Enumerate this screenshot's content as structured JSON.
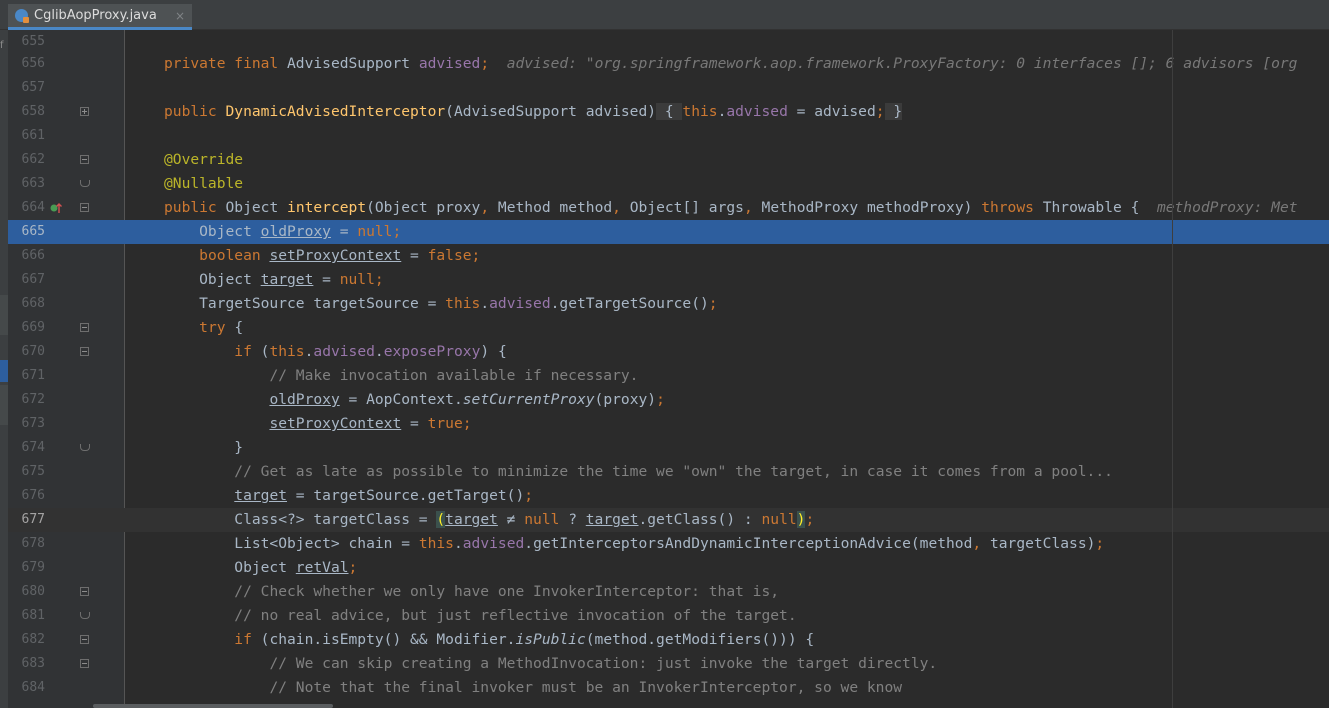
{
  "tab": {
    "filename": "CglibAopProxy.java",
    "close_glyph": "×"
  },
  "lines": [
    {
      "num": "655"
    },
    {
      "num": "656"
    },
    {
      "num": "657"
    },
    {
      "num": "658"
    },
    {
      "num": "661"
    },
    {
      "num": "662"
    },
    {
      "num": "663"
    },
    {
      "num": "664"
    },
    {
      "num": "665"
    },
    {
      "num": "666"
    },
    {
      "num": "667"
    },
    {
      "num": "668"
    },
    {
      "num": "669"
    },
    {
      "num": "670"
    },
    {
      "num": "671"
    },
    {
      "num": "672"
    },
    {
      "num": "673"
    },
    {
      "num": "674"
    },
    {
      "num": "675"
    },
    {
      "num": "676"
    },
    {
      "num": "677"
    },
    {
      "num": "678"
    },
    {
      "num": "679"
    },
    {
      "num": "680"
    },
    {
      "num": "681"
    },
    {
      "num": "682"
    },
    {
      "num": "683"
    },
    {
      "num": "684"
    }
  ],
  "inline_hints": {
    "advised": "advised: \"org.springframework.aop.framework.ProxyFactory: 0 interfaces []; 6 advisors [org",
    "methodProxy": "methodProxy: Met"
  },
  "colors": {
    "keyword": "#cc7832",
    "field": "#9876aa",
    "method_decl": "#ffc66d",
    "annotation": "#bbb529",
    "comment": "#808080",
    "execution_line": "#2d5e9e"
  },
  "icons": {
    "tab_file": "java-class-icon",
    "gutter_664": "override-method-icon"
  }
}
